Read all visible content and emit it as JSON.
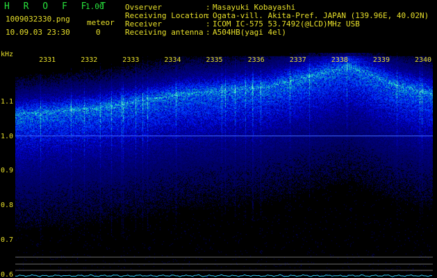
{
  "header": {
    "app_title": "H R O F F T",
    "version": "1.00",
    "filename": "1009032330.png",
    "datetime": "10.09.03 23:30",
    "meteor_label": "meteor",
    "meteor_count": "0"
  },
  "info": [
    {
      "label": "Ovserver",
      "sep": ":",
      "value": "Masayuki Kobayashi"
    },
    {
      "label": "Receiving Location",
      "sep": ":",
      "value": "Ogata-vill. Akita-Pref. JAPAN (139.96E, 40.02N)"
    },
    {
      "label": "Receiver",
      "sep": ":",
      "value": "ICOM IC-575 53.7492(@LCD)MHz USB"
    },
    {
      "label": "Receiving antenna",
      "sep": ":",
      "value": "A504HB(yagi 4el)"
    }
  ],
  "colors": {
    "background": "#000000",
    "label_text": "#e8e02a",
    "title_text": "#28e03c",
    "reference_line": "#3b66ff",
    "baseline": "#cfcfcf",
    "signal_trace": "#30c8f0"
  },
  "chart_data": {
    "type": "heatmap",
    "ylabel": "kHz",
    "yticks": [
      "1.1",
      "1.0",
      "0.9",
      "0.8",
      "0.7",
      "0.6"
    ],
    "ylim": [
      0.59,
      1.24
    ],
    "reference_line_khz": 1.0,
    "xticks": [
      "2331",
      "2332",
      "2333",
      "2334",
      "2335",
      "2336",
      "2337",
      "2338",
      "2339",
      "2340"
    ],
    "x_range_minutes": [
      2330,
      2340
    ],
    "trace_minutes": [
      2330,
      2331,
      2332,
      2333,
      2334,
      2335,
      2336,
      2337,
      2338,
      2339,
      2340
    ],
    "trace_khz": [
      1.06,
      1.07,
      1.08,
      1.1,
      1.12,
      1.13,
      1.14,
      1.17,
      1.2,
      1.15,
      1.12
    ]
  }
}
